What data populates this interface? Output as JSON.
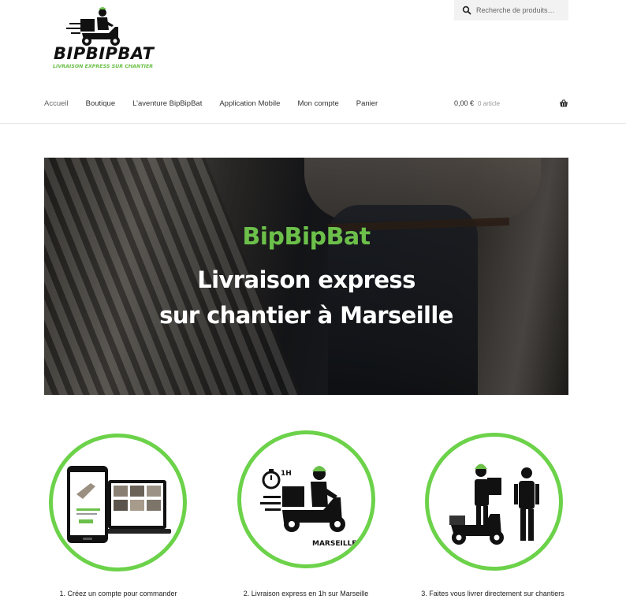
{
  "logo": {
    "wordmark": "BIPBIPBAT",
    "tagline": "LIVRAISON EXPRESS SUR CHANTIER"
  },
  "search": {
    "placeholder": "Recherche de produits…"
  },
  "nav": [
    "Accueil",
    "Boutique",
    "L’aventure BipBipBat",
    "Application Mobile",
    "Mon compte",
    "Panier"
  ],
  "cart": {
    "total": "0,00 €",
    "count": "0 article"
  },
  "hero": {
    "brand": "BipBipBat",
    "line1": "Livraison express",
    "line2": "sur chantier à Marseille"
  },
  "steps": [
    {
      "label": "1. Créez un compte pour commander"
    },
    {
      "label": "2. Livraison express en 1h sur Marseille",
      "timer": "1H",
      "city": "MARSEILLE"
    },
    {
      "label": "3. Faites vous livrer directement sur chantiers"
    }
  ],
  "colors": {
    "accent": "#6cc04a",
    "circle": "#6cd24a"
  }
}
